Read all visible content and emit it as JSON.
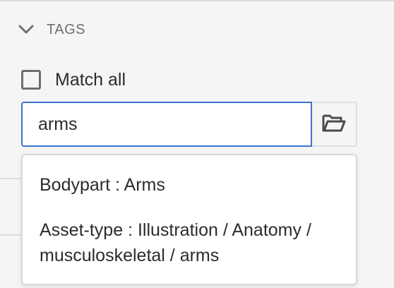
{
  "tags_section": {
    "title": "TAGS",
    "toggle_icon": "chevron-down-icon"
  },
  "match_all": {
    "label": "Match all",
    "checked": false
  },
  "tag_search": {
    "value": "arms",
    "picker_icon": "folder-open-icon"
  },
  "suggestions": [
    {
      "label": "Bodypart : Arms"
    },
    {
      "label": "Asset-type : Illustration / Anatomy / musculoskeletal / arms"
    }
  ],
  "colors": {
    "focus_border": "#3b73d4",
    "background": "#f5f5f5"
  }
}
